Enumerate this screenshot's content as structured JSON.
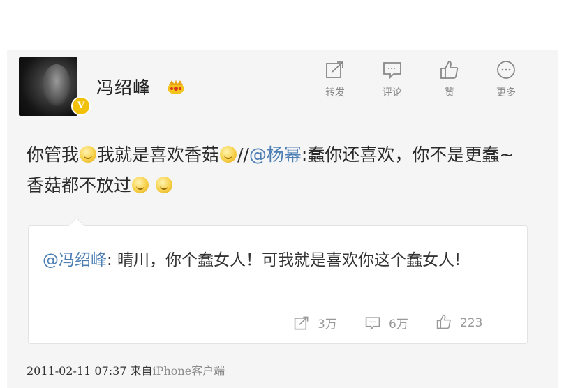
{
  "user": {
    "name": "冯绍峰",
    "verified_badge": "V",
    "crown_icon": "crown-icon",
    "verified_color": "#f2c10a"
  },
  "actions": [
    {
      "label": "转发",
      "icon": "repost-icon"
    },
    {
      "label": "评论",
      "icon": "comment-icon"
    },
    {
      "label": "赞",
      "icon": "like-icon"
    },
    {
      "label": "更多",
      "icon": "more-icon"
    }
  ],
  "post": {
    "text_1": "你管我",
    "text_2": "我就是喜欢香菇",
    "text_3": "//",
    "mention": "@杨幂",
    "text_4": ":蠢你还喜欢，你不是更蠢~香菇都不放过",
    "emoji_icons": [
      "grin-emoji",
      "tongue-emoji",
      "sweat-emoji",
      "think-emoji"
    ]
  },
  "quote": {
    "mention": "@冯绍峰",
    "text": ": 晴川，你个蠢女人！可我就是喜欢你这个蠢女人!",
    "reposts": "3万",
    "comments": "6万",
    "likes": "223"
  },
  "footer": {
    "datetime": "2011-02-11 07:37",
    "from": "来自",
    "source": "iPhone客户端"
  },
  "colors": {
    "link": "#4d7fb5",
    "background": "#f5f5f5"
  }
}
